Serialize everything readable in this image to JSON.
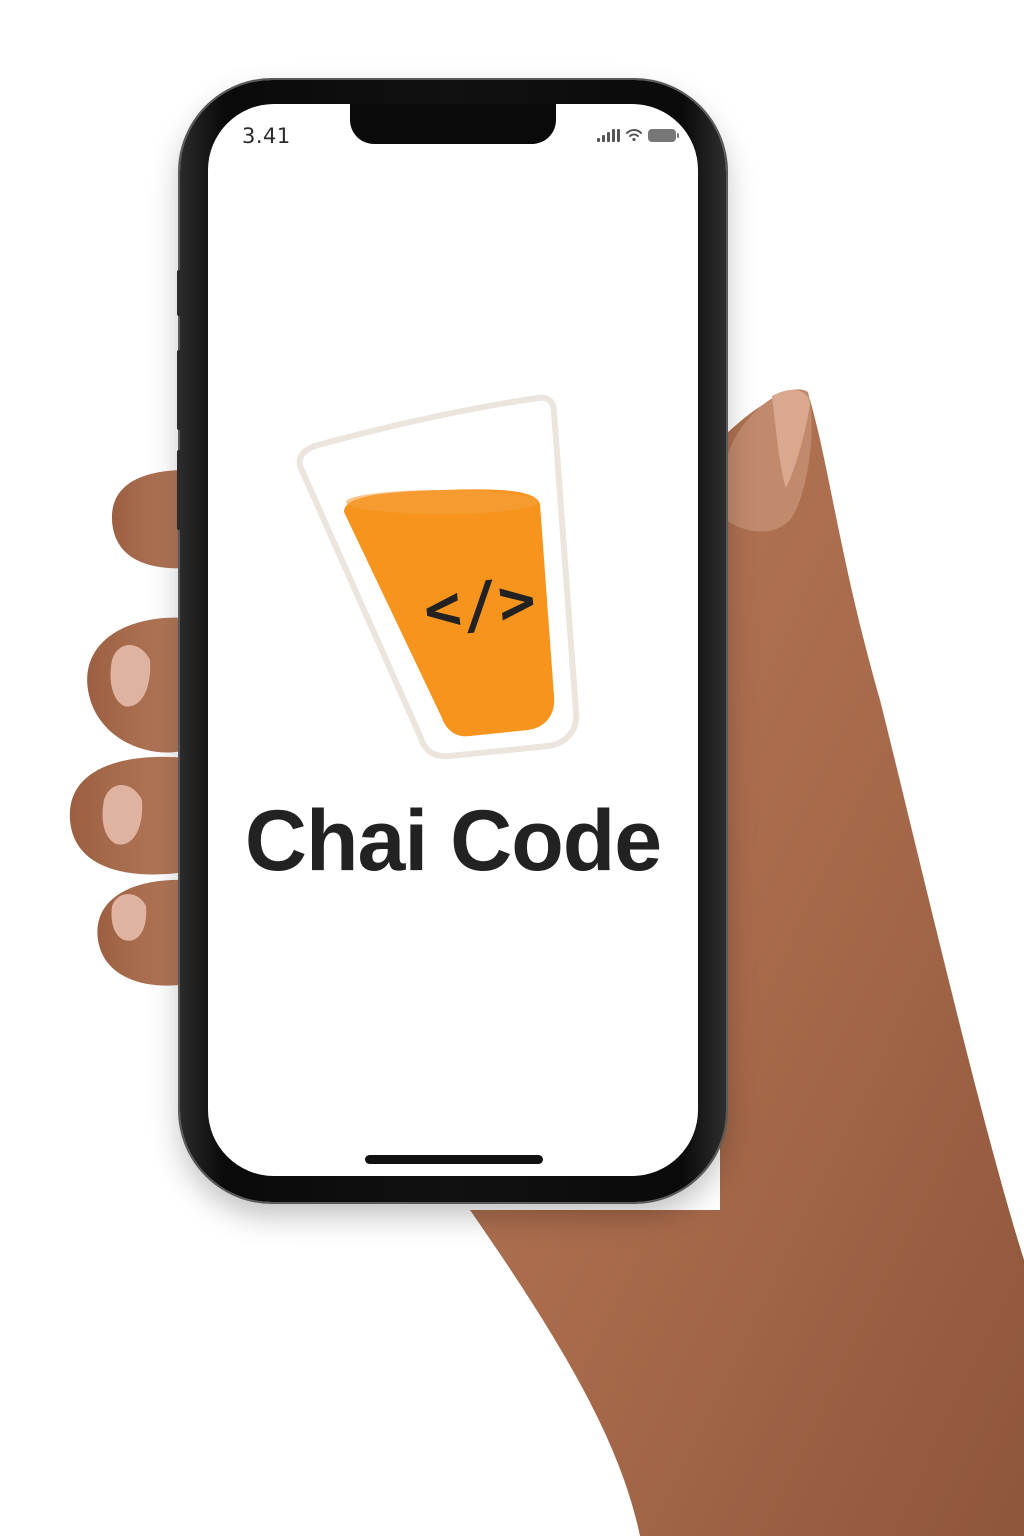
{
  "status_bar": {
    "time": "3.41",
    "icons": [
      "signal-icon",
      "wifi-icon",
      "battery-icon"
    ]
  },
  "app": {
    "title": "Chai Code",
    "logo_icon": "chai-glass-code-icon",
    "logo_glyph": "</>"
  },
  "colors": {
    "brand_orange": "#F7941D",
    "title_text": "#222222",
    "glass_outline": "#E9E3DC",
    "screen_background": "#FFFFFF"
  }
}
